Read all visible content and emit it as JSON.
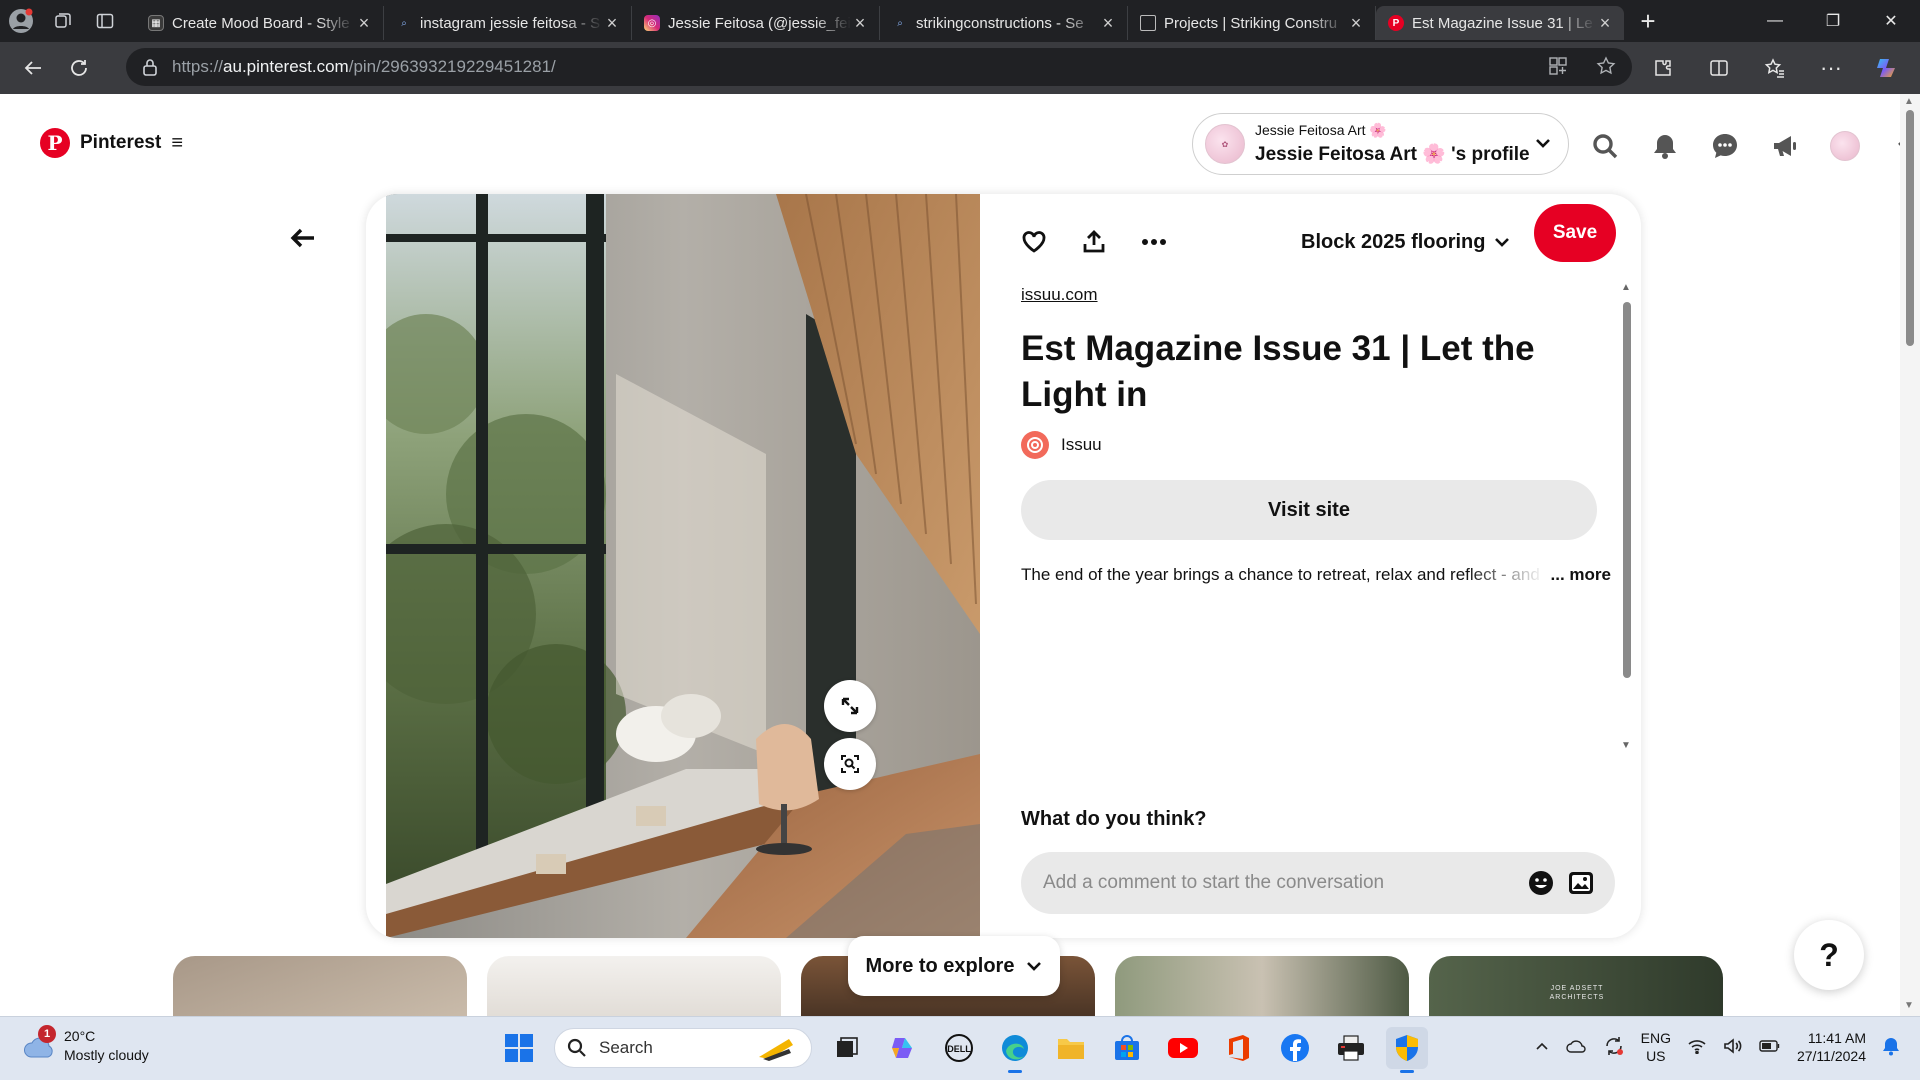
{
  "browser": {
    "tabs": [
      {
        "title": "Create Mood Board - Style",
        "favicon": "mood-board",
        "color": "#3a3a3a",
        "active": false
      },
      {
        "title": "instagram jessie feitosa - S",
        "favicon": "search",
        "color": "#4a5a88",
        "active": false
      },
      {
        "title": "Jessie Feitosa (@jessie_fei",
        "favicon": "instagram",
        "color": "#d6249f",
        "active": false
      },
      {
        "title": "strikingconstructions - Se",
        "favicon": "search",
        "color": "#4a5a88",
        "active": false
      },
      {
        "title": "Projects | Striking Constru",
        "favicon": "page",
        "color": "#5f6368",
        "active": false
      },
      {
        "title": "Est Magazine Issue 31 | Le",
        "favicon": "pinterest",
        "color": "#e60023",
        "active": true
      }
    ],
    "url_host": "au.pinterest.com",
    "url_prefix": "https://",
    "url_path": "/pin/296393219229451281/"
  },
  "header": {
    "logo_text": "Pinterest",
    "profile_small": "Jessie Feitosa Art 🌸",
    "profile_big": "Jessie Feitosa Art 🌸 's profile",
    "icons": [
      "search-icon",
      "bell-icon",
      "messages-icon",
      "megaphone-icon",
      "avatar",
      "chevron-down-icon"
    ]
  },
  "pin": {
    "board": "Block 2025 flooring",
    "save_label": "Save",
    "source": "issuu.com",
    "title": "Est Magazine Issue 31 | Let the Light in",
    "author": "Issuu",
    "visit_label": "Visit site",
    "description": "The end of the year brings a chance to retreat, relax and reflect - and",
    "more_label": "... more",
    "comments_heading": "What do you think?",
    "comment_placeholder": "Add a comment to start the conversation"
  },
  "explore": {
    "more_label": "More to explore",
    "thumb_colors": [
      "#b8ab9c",
      "#e8e4df",
      "#6b4a33",
      "#7f8b74",
      "#3f4a3c"
    ],
    "thumb_logo": "JOE ADSETT ARCHITECTS"
  },
  "help_label": "?",
  "taskbar": {
    "weather_temp": "20°C",
    "weather_desc": "Mostly cloudy",
    "weather_badge": "1",
    "search_label": "Search",
    "lang_top": "ENG",
    "lang_bottom": "US",
    "time": "11:41 AM",
    "date": "27/11/2024"
  },
  "colors": {
    "pinterest_red": "#e60023",
    "browser_dark": "#202124",
    "browser_toolbar": "#3a3b3f"
  }
}
